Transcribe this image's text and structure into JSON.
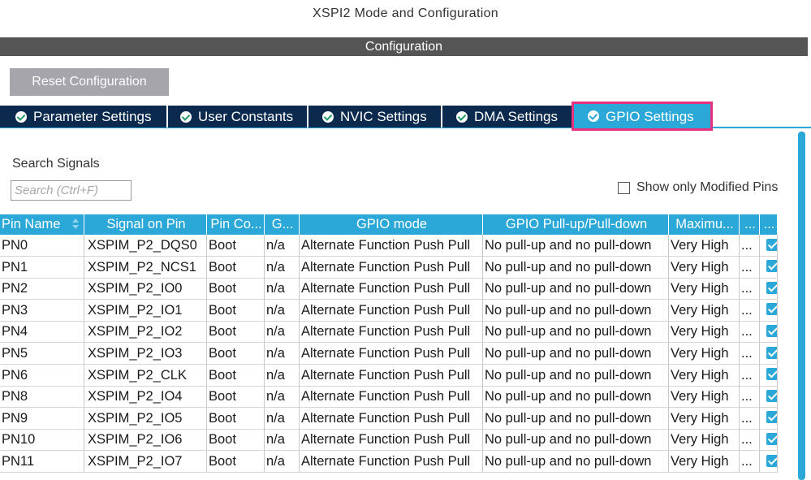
{
  "window": {
    "title": "XSPI2 Mode and Configuration"
  },
  "section": {
    "title": "Configuration"
  },
  "toolbar": {
    "reset_label": "Reset Configuration"
  },
  "tabs": [
    {
      "label": "Parameter Settings",
      "icon": "check-circle-icon"
    },
    {
      "label": "User Constants",
      "icon": "check-circle-icon"
    },
    {
      "label": "NVIC Settings",
      "icon": "check-circle-icon"
    },
    {
      "label": "DMA Settings",
      "icon": "check-circle-icon"
    },
    {
      "label": "GPIO Settings",
      "icon": "check-circle-icon",
      "active": true
    }
  ],
  "search": {
    "label": "Search Signals",
    "placeholder": "Search (Ctrl+F)",
    "value": ""
  },
  "filter": {
    "label": "Show only Modified Pins",
    "checked": false
  },
  "table": {
    "columns": [
      "Pin Name",
      "Signal on Pin",
      "Pin Co...",
      "G...",
      "GPIO mode",
      "GPIO Pull-up/Pull-down",
      "Maximu...",
      "...",
      "..."
    ],
    "rows": [
      {
        "pin": "PN0",
        "signal": "XSPIM_P2_DQS0",
        "context": "Boot",
        "gpio": "n/a",
        "mode": "Alternate Function Push Pull",
        "pull": "No pull-up and no pull-down",
        "speed": "Very High",
        "extra": "...",
        "checked": true
      },
      {
        "pin": "PN1",
        "signal": "XSPIM_P2_NCS1",
        "context": "Boot",
        "gpio": "n/a",
        "mode": "Alternate Function Push Pull",
        "pull": "No pull-up and no pull-down",
        "speed": "Very High",
        "extra": "...",
        "checked": true
      },
      {
        "pin": "PN2",
        "signal": "XSPIM_P2_IO0",
        "context": "Boot",
        "gpio": "n/a",
        "mode": "Alternate Function Push Pull",
        "pull": "No pull-up and no pull-down",
        "speed": "Very High",
        "extra": "...",
        "checked": true
      },
      {
        "pin": "PN3",
        "signal": "XSPIM_P2_IO1",
        "context": "Boot",
        "gpio": "n/a",
        "mode": "Alternate Function Push Pull",
        "pull": "No pull-up and no pull-down",
        "speed": "Very High",
        "extra": "...",
        "checked": true
      },
      {
        "pin": "PN4",
        "signal": "XSPIM_P2_IO2",
        "context": "Boot",
        "gpio": "n/a",
        "mode": "Alternate Function Push Pull",
        "pull": "No pull-up and no pull-down",
        "speed": "Very High",
        "extra": "...",
        "checked": true
      },
      {
        "pin": "PN5",
        "signal": "XSPIM_P2_IO3",
        "context": "Boot",
        "gpio": "n/a",
        "mode": "Alternate Function Push Pull",
        "pull": "No pull-up and no pull-down",
        "speed": "Very High",
        "extra": "...",
        "checked": true
      },
      {
        "pin": "PN6",
        "signal": "XSPIM_P2_CLK",
        "context": "Boot",
        "gpio": "n/a",
        "mode": "Alternate Function Push Pull",
        "pull": "No pull-up and no pull-down",
        "speed": "Very High",
        "extra": "...",
        "checked": true
      },
      {
        "pin": "PN8",
        "signal": "XSPIM_P2_IO4",
        "context": "Boot",
        "gpio": "n/a",
        "mode": "Alternate Function Push Pull",
        "pull": "No pull-up and no pull-down",
        "speed": "Very High",
        "extra": "...",
        "checked": true
      },
      {
        "pin": "PN9",
        "signal": "XSPIM_P2_IO5",
        "context": "Boot",
        "gpio": "n/a",
        "mode": "Alternate Function Push Pull",
        "pull": "No pull-up and no pull-down",
        "speed": "Very High",
        "extra": "...",
        "checked": true
      },
      {
        "pin": "PN10",
        "signal": "XSPIM_P2_IO6",
        "context": "Boot",
        "gpio": "n/a",
        "mode": "Alternate Function Push Pull",
        "pull": "No pull-up and no pull-down",
        "speed": "Very High",
        "extra": "...",
        "checked": true
      },
      {
        "pin": "PN11",
        "signal": "XSPIM_P2_IO7",
        "context": "Boot",
        "gpio": "n/a",
        "mode": "Alternate Function Push Pull",
        "pull": "No pull-up and no pull-down",
        "speed": "Very High",
        "extra": "...",
        "checked": true
      }
    ]
  },
  "colors": {
    "accent": "#2ca8d8",
    "tab_bg": "#0b2a4e",
    "highlight": "#e6337f",
    "header_bar": "#555555",
    "button": "#a5a5ab"
  }
}
